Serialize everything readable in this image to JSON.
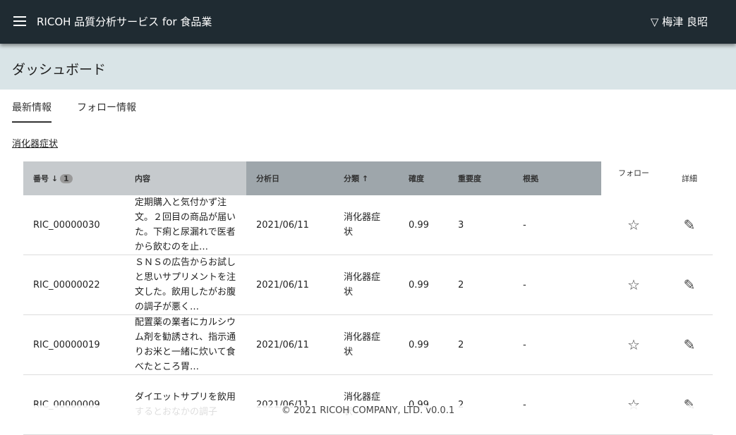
{
  "header": {
    "app_title": "RICOH 品質分析サービス for 食品業",
    "user": "▽ 梅津 良昭"
  },
  "page_title": "ダッシュボード",
  "tabs": [
    {
      "label": "最新情報"
    },
    {
      "label": "フォロー情報"
    }
  ],
  "filter_link": "消化器症状",
  "table": {
    "headers": {
      "id": "番号 ↓",
      "sort_badge": "1",
      "content": "内容",
      "date": "分析日",
      "category": "分類 ↑",
      "confidence": "確度",
      "importance": "重要度",
      "basis": "根拠",
      "follow": "フォロー",
      "detail": "詳細"
    },
    "rows": [
      {
        "id": "RIC_00000030",
        "content": "定期購入と気付かず注文。２回目の商品が届いた。下痢と尿漏れで医者から飲むのを止…",
        "date": "2021/06/11",
        "category": "消化器症状",
        "confidence": "0.99",
        "importance": "3",
        "basis": "-"
      },
      {
        "id": "RIC_00000022",
        "content": "ＳＮＳの広告からお試しと思いサプリメントを注文した。飲用したがお腹の調子が悪く…",
        "date": "2021/06/11",
        "category": "消化器症状",
        "confidence": "0.99",
        "importance": "2",
        "basis": "-"
      },
      {
        "id": "RIC_00000019",
        "content": "配置薬の業者にカルシウム剤を勧誘され、指示通りお米と一緒に炊いて食べたところ胃…",
        "date": "2021/06/11",
        "category": "消化器症状",
        "confidence": "0.99",
        "importance": "2",
        "basis": "-"
      },
      {
        "id": "RIC_00000009",
        "content": "ダイエットサプリを飲用するとおなかの調子",
        "date": "2021/06/11",
        "category": "消化器症状",
        "confidence": "0.99",
        "importance": "2",
        "basis": "-"
      }
    ]
  },
  "footer": "© 2021 RICOH COMPANY, LTD. v0.0.1"
}
